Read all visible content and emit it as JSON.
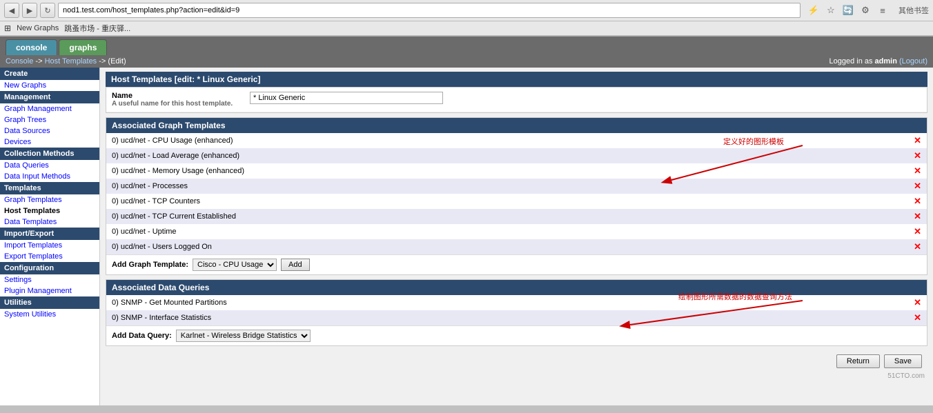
{
  "browser": {
    "url": "nod1.test.com/host_templates.php?action=edit&id=9",
    "back_icon": "◀",
    "forward_icon": "▶",
    "reload_icon": "↻",
    "bookmarks": [
      "应用",
      "跳蚤市场 - 重庆驿..."
    ],
    "other_bookmarks": "其他书签"
  },
  "tabs": {
    "console_label": "console",
    "graphs_label": "graphs"
  },
  "breadcrumb": {
    "console": "Console",
    "arrow1": "->",
    "host_templates": "Host Templates",
    "arrow2": "->",
    "edit": "(Edit)"
  },
  "logged_in": {
    "prefix": "Logged in as",
    "user": "admin",
    "logout": "(Logout)"
  },
  "sidebar": {
    "create_header": "Create",
    "new_graphs": "New Graphs",
    "management_header": "Management",
    "graph_management": "Graph Management",
    "graph_trees": "Graph Trees",
    "data_sources": "Data Sources",
    "devices": "Devices",
    "collection_header": "Collection Methods",
    "data_queries": "Data Queries",
    "data_input_methods": "Data Input Methods",
    "templates_header": "Templates",
    "graph_templates": "Graph Templates",
    "host_templates": "Host Templates",
    "data_templates": "Data Templates",
    "import_export_header": "Import/Export",
    "import_templates": "Import Templates",
    "export_templates": "Export Templates",
    "configuration_header": "Configuration",
    "settings": "Settings",
    "plugin_management": "Plugin Management",
    "utilities_header": "Utilities",
    "system_utilities": "System Utilities"
  },
  "page_title": "Host Templates [edit: * Linux Generic]",
  "name_section": {
    "label": "Name",
    "description": "A useful name for this host template.",
    "value": "* Linux Generic"
  },
  "associated_graph_templates": {
    "header": "Associated Graph Templates",
    "items": [
      "0) ucd/net - CPU Usage (enhanced)",
      "0) ucd/net - Load Average (enhanced)",
      "0) ucd/net - Memory Usage (enhanced)",
      "0) ucd/net - Processes",
      "0) ucd/net - TCP Counters",
      "0) ucd/net - TCP Current Established",
      "0) ucd/net - Uptime",
      "0) ucd/net - Users Logged On"
    ],
    "add_label": "Add Graph Template:",
    "add_dropdown_value": "Cisco - CPU Usage",
    "add_button": "Add",
    "annotation": "定义好的图形模板"
  },
  "associated_data_queries": {
    "header": "Associated Data Queries",
    "items": [
      "0) SNMP - Get Mounted Partitions",
      "0) SNMP - Interface Statistics"
    ],
    "add_label": "Add Data Query:",
    "add_dropdown_value": "Karlnet - Wireless Bridge Statistics",
    "annotation": "绘制图形所需数据的数据查询方法"
  },
  "buttons": {
    "return": "Return",
    "save": "Save"
  },
  "watermark": "51CTO.com"
}
